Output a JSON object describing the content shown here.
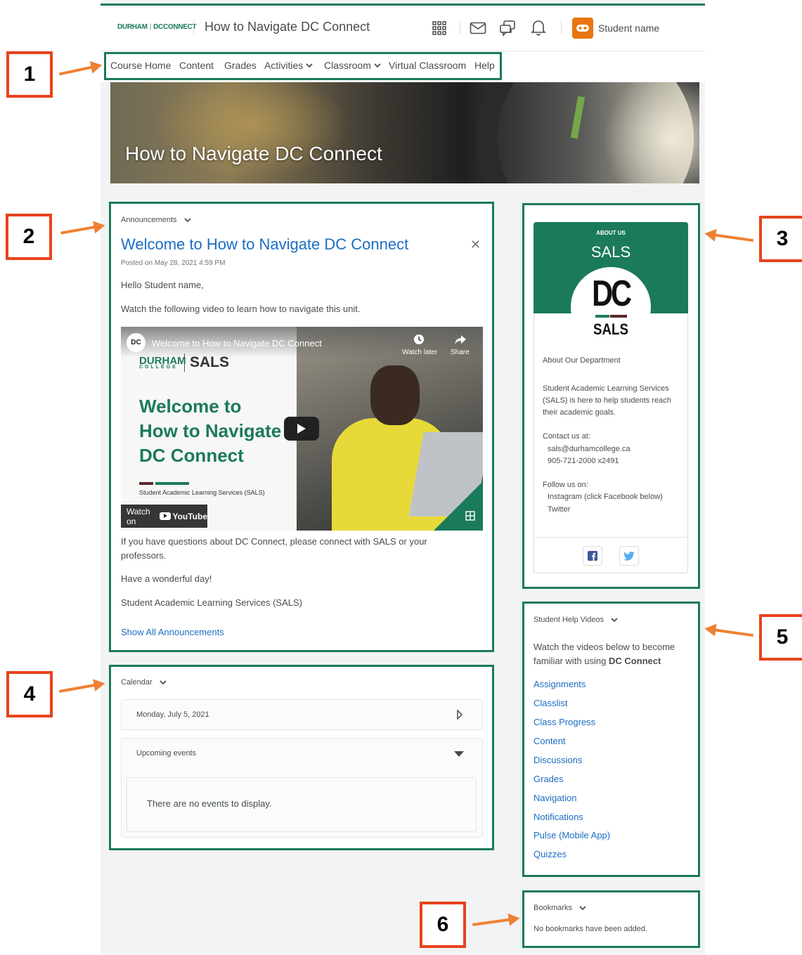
{
  "header": {
    "logo_durham": "DURHAM",
    "logo_dcconnect": "DCCONNECT",
    "course_title": "How to Navigate DC Connect",
    "student_name": "Student name"
  },
  "nav": [
    "Course Home",
    "Content",
    "Grades",
    "Activities",
    "Classroom",
    "Virtual Classroom",
    "Help"
  ],
  "banner": {
    "title": "How to Navigate DC Connect"
  },
  "announcements": {
    "widget_title": "Announcements",
    "heading": "Welcome to How to Navigate DC Connect",
    "posted": "Posted on May 28, 2021 4:59 PM",
    "greeting": "Hello Student name,",
    "intro": "Watch the following video to learn how to navigate this unit.",
    "video": {
      "logo": "DC",
      "title": "Welcome to How to Navigate DC Connect",
      "watch_later": "Watch later",
      "share": "Share",
      "brand_left": "DURHAM",
      "brand_sub": "COLLEGE",
      "brand_right": "SALS",
      "big_line1": "Welcome to",
      "big_line2": "How to Navigate",
      "big_line3": "DC Connect",
      "sub": "Student Academic Learning Services (SALS)",
      "watch_on": "Watch on",
      "youtube": "YouTube"
    },
    "questions_line1": "If you have questions about DC Connect, please connect with SALS or your",
    "questions_line2": "professors.",
    "closing": "Have a wonderful day!",
    "signature": "Student Academic Learning Services (SALS)",
    "show_all": "Show All Announcements"
  },
  "calendar": {
    "widget_title": "Calendar",
    "date": "Monday, July 5, 2021",
    "upcoming": "Upcoming events",
    "empty": "There are no events to display."
  },
  "about": {
    "kicker": "ABOUT US",
    "name": "SALS",
    "logo_dc": "DC",
    "logo_sals": "SALS",
    "heading": "About Our Department",
    "desc": [
      "Student Academic Learning Services",
      "(SALS) is here to help students reach",
      "their academic goals."
    ],
    "contact_label": "Contact us at:",
    "email": "sals@durhamcollege.ca",
    "phone": "905-721-2000 x2491",
    "follow_label": "Follow us on:",
    "instagram": "Instagram (click Facebook below)",
    "twitter": "Twitter"
  },
  "help_videos": {
    "widget_title": "Student Help Videos",
    "intro_line1": "Watch the videos below to become",
    "intro_line2_prefix": "familiar with using ",
    "intro_line2_bold": "DC Connect",
    "links": [
      "Assignments",
      "Classlist",
      "Class Progress",
      "Content",
      "Discussions",
      "Grades",
      "Navigation",
      "Notifications",
      "Pulse (Mobile App)",
      "Quizzes"
    ]
  },
  "bookmarks": {
    "widget_title": "Bookmarks",
    "empty": "No bookmarks have been added."
  },
  "callouts": [
    "1",
    "2",
    "3",
    "4",
    "5",
    "6"
  ],
  "colors": {
    "brand_green": "#1b7a5a",
    "link_blue": "#1b6ec2",
    "callout_red": "#e8431c",
    "arrow_orange": "#ee8133",
    "avatar_orange": "#e87511"
  }
}
